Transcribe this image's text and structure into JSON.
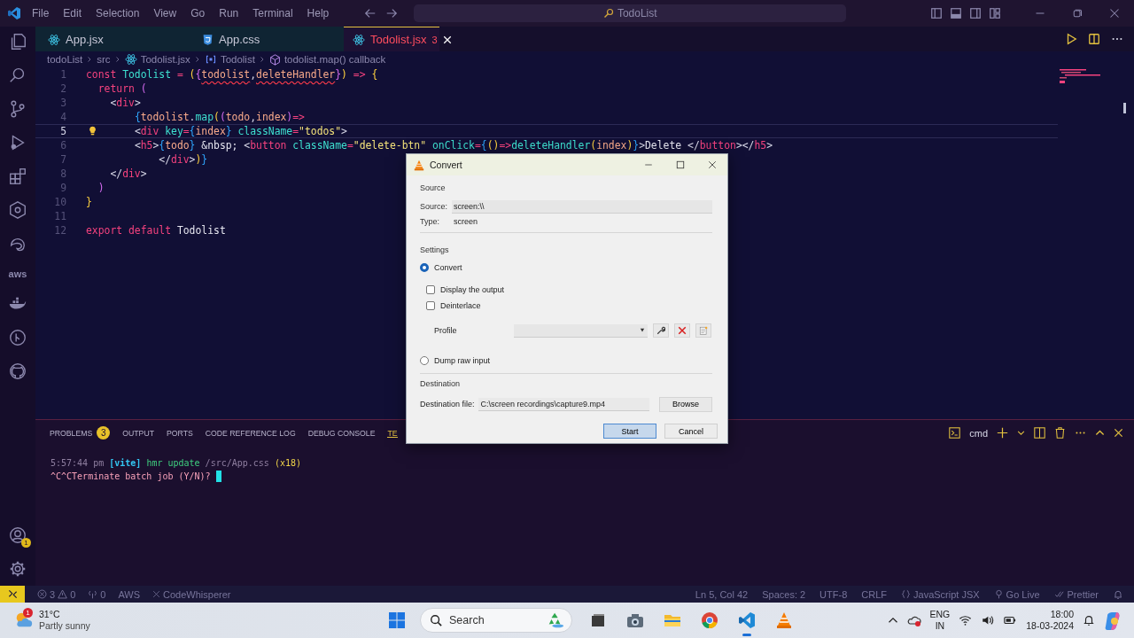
{
  "title_bar": {
    "menu": [
      "File",
      "Edit",
      "Selection",
      "View",
      "Go",
      "Run",
      "Terminal",
      "Help"
    ],
    "search": "TodoList"
  },
  "activity_bar": {
    "aws_label": "aws",
    "account_badge": "1"
  },
  "tabs": [
    {
      "label": "App.jsx",
      "kind": "jsx",
      "selected": false,
      "has_errors": false
    },
    {
      "label": "App.css",
      "kind": "css",
      "selected": false,
      "has_errors": false
    },
    {
      "label": "Todolist.jsx",
      "kind": "jsx",
      "selected": true,
      "has_errors": true,
      "problem_count": "3"
    }
  ],
  "breadcrumb": [
    {
      "label": "todoList",
      "kind": "folder"
    },
    {
      "label": "src",
      "kind": "folder"
    },
    {
      "label": "Todolist.jsx",
      "kind": "jsx"
    },
    {
      "label": "Todolist",
      "kind": "symbol"
    },
    {
      "label": "todolist.map() callback",
      "kind": "method"
    }
  ],
  "editor": {
    "lines": [
      {
        "number": "1",
        "current": false,
        "tokens": [
          {
            "text": "const",
            "kind": "kw"
          },
          {
            "text": " Todolist",
            "kind": "def"
          },
          {
            "text": " = ",
            "kind": "op"
          },
          {
            "text": "(",
            "kind": "b1"
          },
          {
            "text": "{",
            "kind": "b2"
          },
          {
            "text": "todolist",
            "kind": "var-error"
          },
          {
            "text": ",",
            "kind": "punct"
          },
          {
            "text": "deleteHandler",
            "kind": "var-error"
          },
          {
            "text": "}",
            "kind": "b2"
          },
          {
            "text": ")",
            "kind": "b1"
          },
          {
            "text": " => ",
            "kind": "op"
          },
          {
            "text": "{",
            "kind": "b1"
          }
        ]
      },
      {
        "number": "2",
        "current": false,
        "tokens": [
          {
            "text": "  return",
            "kind": "kw"
          },
          {
            "text": " (",
            "kind": "b2"
          }
        ]
      },
      {
        "number": "3",
        "current": false,
        "tokens": [
          {
            "text": "    <",
            "kind": "punct"
          },
          {
            "text": "div",
            "kind": "tag"
          },
          {
            "text": ">",
            "kind": "punct"
          }
        ]
      },
      {
        "number": "4",
        "current": false,
        "tokens": [
          {
            "text": "        {",
            "kind": "b3"
          },
          {
            "text": "todolist",
            "kind": "var"
          },
          {
            "text": ".",
            "kind": "punct"
          },
          {
            "text": "map",
            "kind": "fn"
          },
          {
            "text": "(",
            "kind": "b1"
          },
          {
            "text": "(",
            "kind": "b2"
          },
          {
            "text": "todo",
            "kind": "var"
          },
          {
            "text": ",",
            "kind": "punct"
          },
          {
            "text": "index",
            "kind": "var"
          },
          {
            "text": ")",
            "kind": "b2"
          },
          {
            "text": "=>",
            "kind": "op"
          }
        ]
      },
      {
        "number": "5",
        "current": true,
        "tokens": [
          {
            "text": "        <",
            "kind": "punct"
          },
          {
            "text": "div",
            "kind": "tag"
          },
          {
            "text": " key",
            "kind": "attr"
          },
          {
            "text": "=",
            "kind": "op"
          },
          {
            "text": "{",
            "kind": "b3"
          },
          {
            "text": "index",
            "kind": "var"
          },
          {
            "text": "}",
            "kind": "b3"
          },
          {
            "text": " className",
            "kind": "attr"
          },
          {
            "text": "=",
            "kind": "op"
          },
          {
            "text": "\"todos\"",
            "kind": "string"
          },
          {
            "text": ">",
            "kind": "punct"
          }
        ]
      },
      {
        "number": "6",
        "current": false,
        "tokens": [
          {
            "text": "        <",
            "kind": "punct"
          },
          {
            "text": "h5",
            "kind": "tag"
          },
          {
            "text": ">",
            "kind": "punct"
          },
          {
            "text": "{",
            "kind": "b3"
          },
          {
            "text": "todo",
            "kind": "var"
          },
          {
            "text": "}",
            "kind": "b3"
          },
          {
            "text": " &nbsp; ",
            "kind": "text"
          },
          {
            "text": "<",
            "kind": "punct"
          },
          {
            "text": "button",
            "kind": "tag"
          },
          {
            "text": " className",
            "kind": "attr"
          },
          {
            "text": "=",
            "kind": "op"
          },
          {
            "text": "\"delete-btn\"",
            "kind": "string"
          },
          {
            "text": " onClick",
            "kind": "attr"
          },
          {
            "text": "=",
            "kind": "op"
          },
          {
            "text": "{",
            "kind": "b3"
          },
          {
            "text": "()",
            "kind": "b1"
          },
          {
            "text": "=>",
            "kind": "op"
          },
          {
            "text": "deleteHandler",
            "kind": "fn"
          },
          {
            "text": "(",
            "kind": "b1"
          },
          {
            "text": "index",
            "kind": "var"
          },
          {
            "text": ")",
            "kind": "b1"
          },
          {
            "text": "}",
            "kind": "b3"
          },
          {
            "text": ">",
            "kind": "punct"
          },
          {
            "text": "Delete ",
            "kind": "text"
          },
          {
            "text": "</",
            "kind": "punct"
          },
          {
            "text": "button",
            "kind": "tag"
          },
          {
            "text": "></",
            "kind": "punct"
          },
          {
            "text": "h5",
            "kind": "tag"
          },
          {
            "text": ">",
            "kind": "punct"
          }
        ]
      },
      {
        "number": "7",
        "current": false,
        "tokens": [
          {
            "text": "            </",
            "kind": "punct"
          },
          {
            "text": "div",
            "kind": "tag"
          },
          {
            "text": ">",
            "kind": "punct"
          },
          {
            "text": ")",
            "kind": "b1"
          },
          {
            "text": "}",
            "kind": "b3"
          }
        ]
      },
      {
        "number": "8",
        "current": false,
        "tokens": [
          {
            "text": "    </",
            "kind": "punct"
          },
          {
            "text": "div",
            "kind": "tag"
          },
          {
            "text": ">",
            "kind": "punct"
          }
        ]
      },
      {
        "number": "9",
        "current": false,
        "tokens": [
          {
            "text": "  )",
            "kind": "b2"
          }
        ]
      },
      {
        "number": "10",
        "current": false,
        "tokens": [
          {
            "text": "}",
            "kind": "b1"
          }
        ]
      },
      {
        "number": "11",
        "current": false
      },
      {
        "number": "12",
        "current": false,
        "tokens": [
          {
            "text": "export",
            "kind": "kw"
          },
          {
            "text": " default",
            "kind": "kw"
          },
          {
            "text": " Todolist",
            "kind": "text"
          }
        ]
      }
    ]
  },
  "panel": {
    "tabs": [
      {
        "label": "PROBLEMS",
        "badge": "3",
        "selected": false
      },
      {
        "label": "OUTPUT",
        "selected": false
      },
      {
        "label": "PORTS",
        "selected": false
      },
      {
        "label": "CODE REFERENCE LOG",
        "selected": false
      },
      {
        "label": "DEBUG CONSOLE",
        "selected": false
      },
      {
        "label": "TE",
        "selected": true
      }
    ],
    "terminal_name": "cmd",
    "terminal_lines": [
      [
        {
          "text": "5:57:44 pm ",
          "kind": "dim"
        },
        {
          "text": "[vite]",
          "kind": "accent"
        },
        {
          "text": " hmr update ",
          "kind": "ok"
        },
        {
          "text": "/src/App.css ",
          "kind": "dim"
        },
        {
          "text": "(x18)",
          "kind": "warn"
        }
      ],
      [
        {
          "text": "^C^CTerminate batch job (Y/N)? ",
          "kind": "prompt"
        }
      ]
    ]
  },
  "status_bar": {
    "errors": "3",
    "warnings": "0",
    "ports": "0",
    "left": [
      "AWS",
      "CodeWhisperer"
    ],
    "position": "Ln 5, Col 42",
    "spaces": "Spaces: 2",
    "encoding": "UTF-8",
    "eol": "CRLF",
    "language": "JavaScript JSX",
    "live": "Go Live",
    "formatter": "Prettier"
  },
  "taskbar": {
    "temperature": "31°C",
    "weather": "Partly sunny",
    "weather_badge": "1",
    "search": "Search",
    "language": "ENG",
    "region": "IN",
    "time": "18:00",
    "date": "18-03-2024"
  },
  "dialog": {
    "title": "Convert",
    "source_group": "Source",
    "source_label": "Source:",
    "source_value": "screen:\\\\",
    "type_label": "Type:",
    "type_value": "screen",
    "settings_group": "Settings",
    "modes": [
      {
        "label": "Convert",
        "selected": true
      },
      {
        "label": "Dump raw input",
        "selected": false
      }
    ],
    "options": [
      {
        "label": "Display the output",
        "checked": false
      },
      {
        "label": "Deinterlace",
        "checked": false
      }
    ],
    "profile_label": "Profile",
    "destination_group": "Destination",
    "destination_label": "Destination file:",
    "destination_value": "C:\\screen recordings\\capture9.mp4",
    "browse": "Browse",
    "buttons": [
      {
        "label": "Start",
        "default": true
      },
      {
        "label": "Cancel",
        "default": false
      }
    ]
  }
}
